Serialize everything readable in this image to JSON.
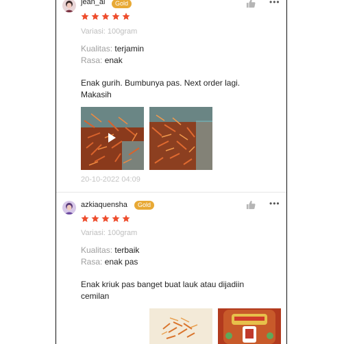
{
  "reviews": [
    {
      "username": "jean_ai",
      "badge": "Gold",
      "rating": 5,
      "variant": "Variasi: 100gram",
      "quality_label": "Kualitas: ",
      "quality_value": "terjamin",
      "taste_label": "Rasa: ",
      "taste_value": "enak",
      "comment": "Enak gurih. Bumbunya pas. Next order lagi. Makasih",
      "date": "20-10-2022 04:09",
      "icons": {
        "avatar": "avatar-photo",
        "like": "thumbs-up-icon",
        "more": "more-options-icon"
      }
    },
    {
      "username": "azkiaquensha",
      "badge": "Gold",
      "rating": 5,
      "variant": "Variasi: 100gram",
      "quality_label": "Kualitas: ",
      "quality_value": "terbaik",
      "taste_label": "Rasa: ",
      "taste_value": "enak pas",
      "comment": "Enak kriuk pas banget buat lauk atau dijadiin cemilan",
      "icons": {
        "avatar": "avatar-photo",
        "like": "thumbs-up-icon",
        "more": "more-options-icon"
      }
    }
  ],
  "colors": {
    "star": "#ee4d2d",
    "badge": "#e8a935",
    "muted": "#bdbdbd"
  }
}
